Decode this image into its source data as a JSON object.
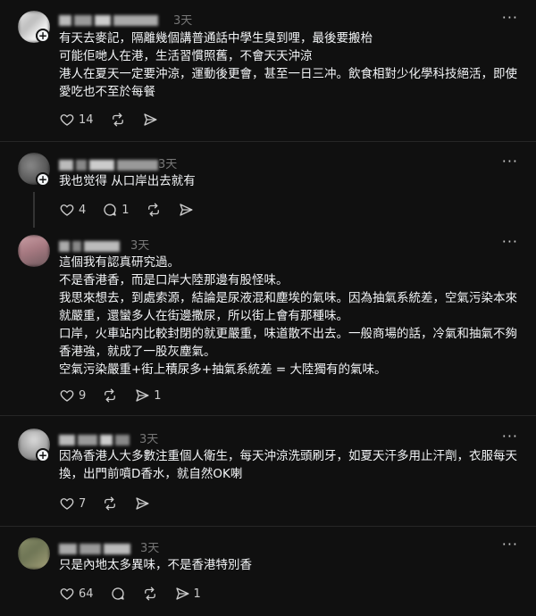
{
  "posts": [
    {
      "time": "3天",
      "text": "有天去麥記，隔離幾個講普通話中學生臭到哩，最後要搬枱\n可能佢哋人在港，生活習慣照舊，不會天天沖涼\n港人在夏天一定要沖涼，運動後更會，甚至一日三冲。飲食相對少化學科技絕活，即使愛吃也不至於每餐",
      "likes": "14",
      "replies": "",
      "reposts": "",
      "shares": ""
    },
    {
      "time": "3天",
      "text": "我也觉得 从口岸出去就有",
      "likes": "4",
      "replies": "1",
      "reposts": "",
      "shares": ""
    },
    {
      "time": "3天",
      "text": "這個我有認真研究過。\n不是香港香，而是口岸大陸那邊有股怪味。\n我思來想去，到處索源，結論是尿液混和塵埃的氣味。因為抽氣系統差，空氣污染本來就嚴重，還蠻多人在街邊撒尿，所以街上會有那種味。\n口岸，火車站内比較封閉的就更嚴重，味道散不出去。一般商場的話，冷氣和抽氣不夠香港強，就成了一股灰塵氣。\n空氣污染嚴重+街上積尿多+抽氣系統差 = 大陸獨有的氣味。",
      "likes": "9",
      "replies": "",
      "reposts": "",
      "shares": "1"
    },
    {
      "time": "3天",
      "text": "因為香港人大多數注重個人衛生，每天沖涼洗頭刷牙，如夏天汗多用止汗劑，衣服每天換，出門前噴D香水，就自然OK喇",
      "likes": "7",
      "replies": "",
      "reposts": "",
      "shares": ""
    },
    {
      "time": "3天",
      "text": "只是內地太多異味，不是香港特別香",
      "likes": "64",
      "replies": "",
      "reposts": "",
      "shares": "1"
    }
  ],
  "icons": {
    "like": "heart-icon",
    "reply": "comment-icon",
    "repost": "repost-icon",
    "share": "send-icon",
    "more": "more-icon",
    "follow": "plus-icon"
  },
  "colors": {
    "background": "#101010",
    "text": "#f3f5f7",
    "muted": "#777777",
    "divider": "#262626"
  }
}
